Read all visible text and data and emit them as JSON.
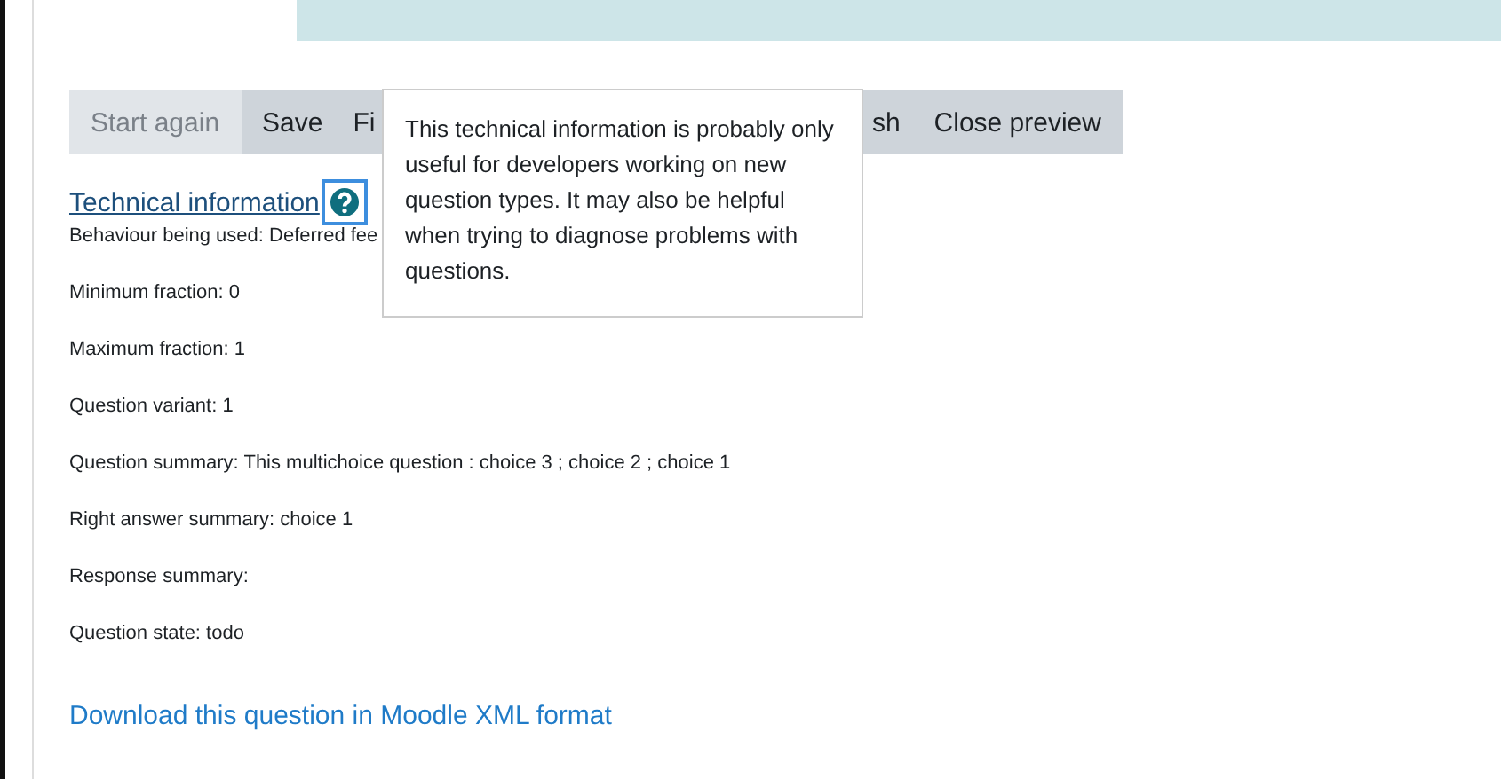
{
  "buttons": [
    {
      "label": "Start again",
      "disabled": true,
      "kind": "full"
    },
    {
      "label": "Save",
      "disabled": false,
      "kind": "full"
    },
    {
      "label": "Fi",
      "disabled": false,
      "kind": "cut-end"
    },
    {
      "label": "sh",
      "disabled": false,
      "kind": "cut-start"
    },
    {
      "label": "Close preview",
      "disabled": false,
      "kind": "full"
    }
  ],
  "technical_info": {
    "heading": "Technical information",
    "tooltip": "This technical information is probably only useful for developers working on new question types. It may also be helpful when trying to diagnose problems with questions.",
    "lines": [
      "Behaviour being used: Deferred fee",
      "Minimum fraction: 0",
      "Maximum fraction: 1",
      "Question variant: 1",
      "Question summary: This multichoice question : choice 3 ; choice 2 ; choice 1",
      "Right answer summary: choice 1",
      "Response summary:",
      "Question state: todo"
    ]
  },
  "download_link": "Download this question in Moodle XML format"
}
